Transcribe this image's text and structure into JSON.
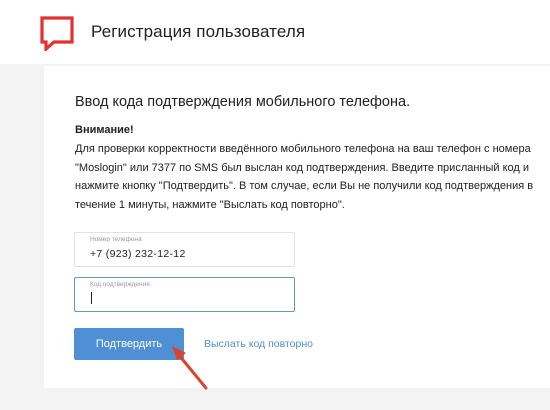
{
  "header": {
    "title": "Регистрация пользователя",
    "logo_icon": "speech-bubble-logo",
    "brand_color": "#e3322d"
  },
  "card": {
    "title": "Ввод кода подтверждения мобильного телефона.",
    "notice_title": "Внимание!",
    "notice_text": "Для проверки корректности введённого мобильного телефона на ваш телефон с номера \"Moslogin\" или 7377 по SMS был выслан код подтверждения. Введите присланный код и нажмите кнопку \"Подтвердить\". В том случае, если Вы не получили код подтверждения в течение 1 минуты, нажмите \"Выслать код повторно\"."
  },
  "form": {
    "phone_label": "Номер телефона",
    "phone_value": "+7 (923) 232-12-12",
    "code_label": "Код подтверждения",
    "code_value": "",
    "submit_label": "Подтвердить",
    "resend_label": "Выслать код повторно"
  },
  "colors": {
    "accent": "#4f8fd6",
    "focus_border": "#5a9ad6",
    "annotation_arrow": "#d9442b"
  }
}
